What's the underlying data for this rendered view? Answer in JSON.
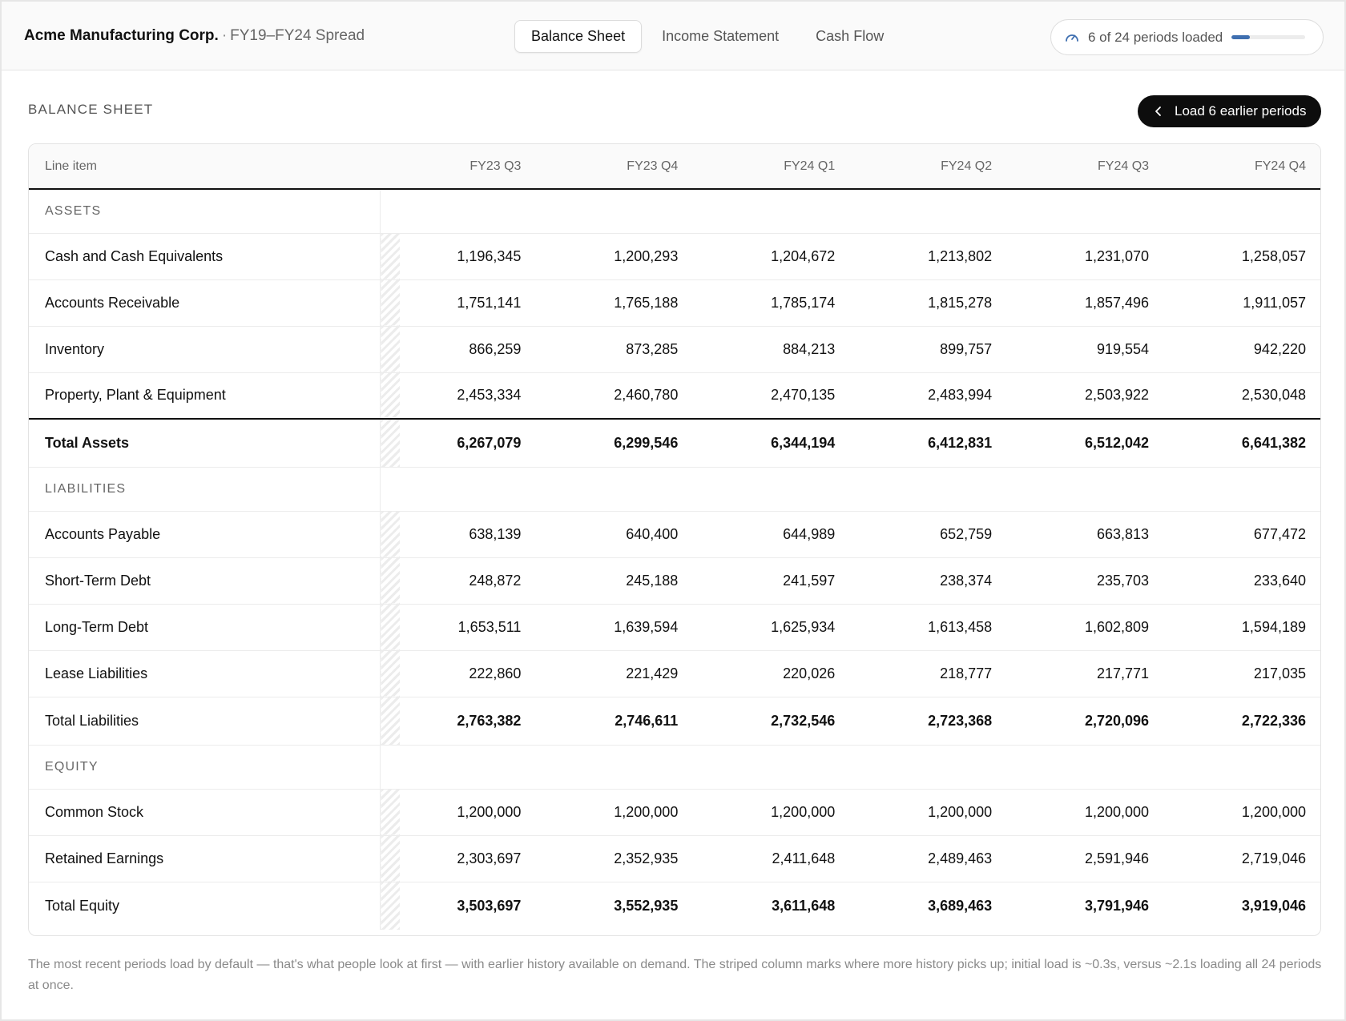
{
  "header": {
    "company": "Acme Manufacturing Corp.",
    "separator": "·",
    "subtitle": "FY19–FY24 Spread",
    "tabs": [
      {
        "label": "Balance Sheet",
        "active": true
      },
      {
        "label": "Income Statement",
        "active": false
      },
      {
        "label": "Cash Flow",
        "active": false
      }
    ],
    "load_status": {
      "text": "6 of 24 periods loaded",
      "loaded": 6,
      "total": 24,
      "icon": "gauge-icon"
    }
  },
  "section": {
    "title": "BALANCE SHEET",
    "load_button": "Load 6 earlier periods",
    "load_button_icon": "chevron-left-icon"
  },
  "table": {
    "label_header": "Line item",
    "periods": [
      "FY23 Q3",
      "FY23 Q4",
      "FY24 Q1",
      "FY24 Q2",
      "FY24 Q3",
      "FY24 Q4"
    ],
    "groups": [
      {
        "name": "ASSETS",
        "rows": [
          {
            "label": "Cash and Cash Equivalents",
            "values": [
              "1,196,345",
              "1,200,293",
              "1,204,672",
              "1,213,802",
              "1,231,070",
              "1,258,057"
            ]
          },
          {
            "label": "Accounts Receivable",
            "values": [
              "1,751,141",
              "1,765,188",
              "1,785,174",
              "1,815,278",
              "1,857,496",
              "1,911,057"
            ]
          },
          {
            "label": "Inventory",
            "values": [
              "866,259",
              "873,285",
              "884,213",
              "899,757",
              "919,554",
              "942,220"
            ]
          },
          {
            "label": "Property, Plant & Equipment",
            "values": [
              "2,453,334",
              "2,460,780",
              "2,470,135",
              "2,483,994",
              "2,503,922",
              "2,530,048"
            ]
          }
        ],
        "total": {
          "label": "Total Assets",
          "values": [
            "6,267,079",
            "6,299,546",
            "6,344,194",
            "6,412,831",
            "6,512,042",
            "6,641,382"
          ],
          "style": "grand"
        }
      },
      {
        "name": "LIABILITIES",
        "rows": [
          {
            "label": "Accounts Payable",
            "values": [
              "638,139",
              "640,400",
              "644,989",
              "652,759",
              "663,813",
              "677,472"
            ]
          },
          {
            "label": "Short-Term Debt",
            "values": [
              "248,872",
              "245,188",
              "241,597",
              "238,374",
              "235,703",
              "233,640"
            ]
          },
          {
            "label": "Long-Term Debt",
            "values": [
              "1,653,511",
              "1,639,594",
              "1,625,934",
              "1,613,458",
              "1,602,809",
              "1,594,189"
            ]
          },
          {
            "label": "Lease Liabilities",
            "values": [
              "222,860",
              "221,429",
              "220,026",
              "218,777",
              "217,771",
              "217,035"
            ]
          }
        ],
        "total": {
          "label": "Total Liabilities",
          "values": [
            "2,763,382",
            "2,746,611",
            "2,732,546",
            "2,723,368",
            "2,720,096",
            "2,722,336"
          ],
          "style": "plain"
        }
      },
      {
        "name": "EQUITY",
        "rows": [
          {
            "label": "Common Stock",
            "values": [
              "1,200,000",
              "1,200,000",
              "1,200,000",
              "1,200,000",
              "1,200,000",
              "1,200,000"
            ]
          },
          {
            "label": "Retained Earnings",
            "values": [
              "2,303,697",
              "2,352,935",
              "2,411,648",
              "2,489,463",
              "2,591,946",
              "2,719,046"
            ]
          }
        ],
        "total": {
          "label": "Total Equity",
          "values": [
            "3,503,697",
            "3,552,935",
            "3,611,648",
            "3,689,463",
            "3,791,946",
            "3,919,046"
          ],
          "style": "plain"
        }
      }
    ]
  },
  "footnote": "The most recent periods load by default — that's what people look at first — with earlier history available on demand. The striped column marks where more history picks up; initial load is ~0.3s, versus ~2.1s loading all 24 periods at once.",
  "colors": {
    "accent": "#3f6fb0",
    "button_bg": "#0d0d0d",
    "header_bg": "#fafafa"
  }
}
